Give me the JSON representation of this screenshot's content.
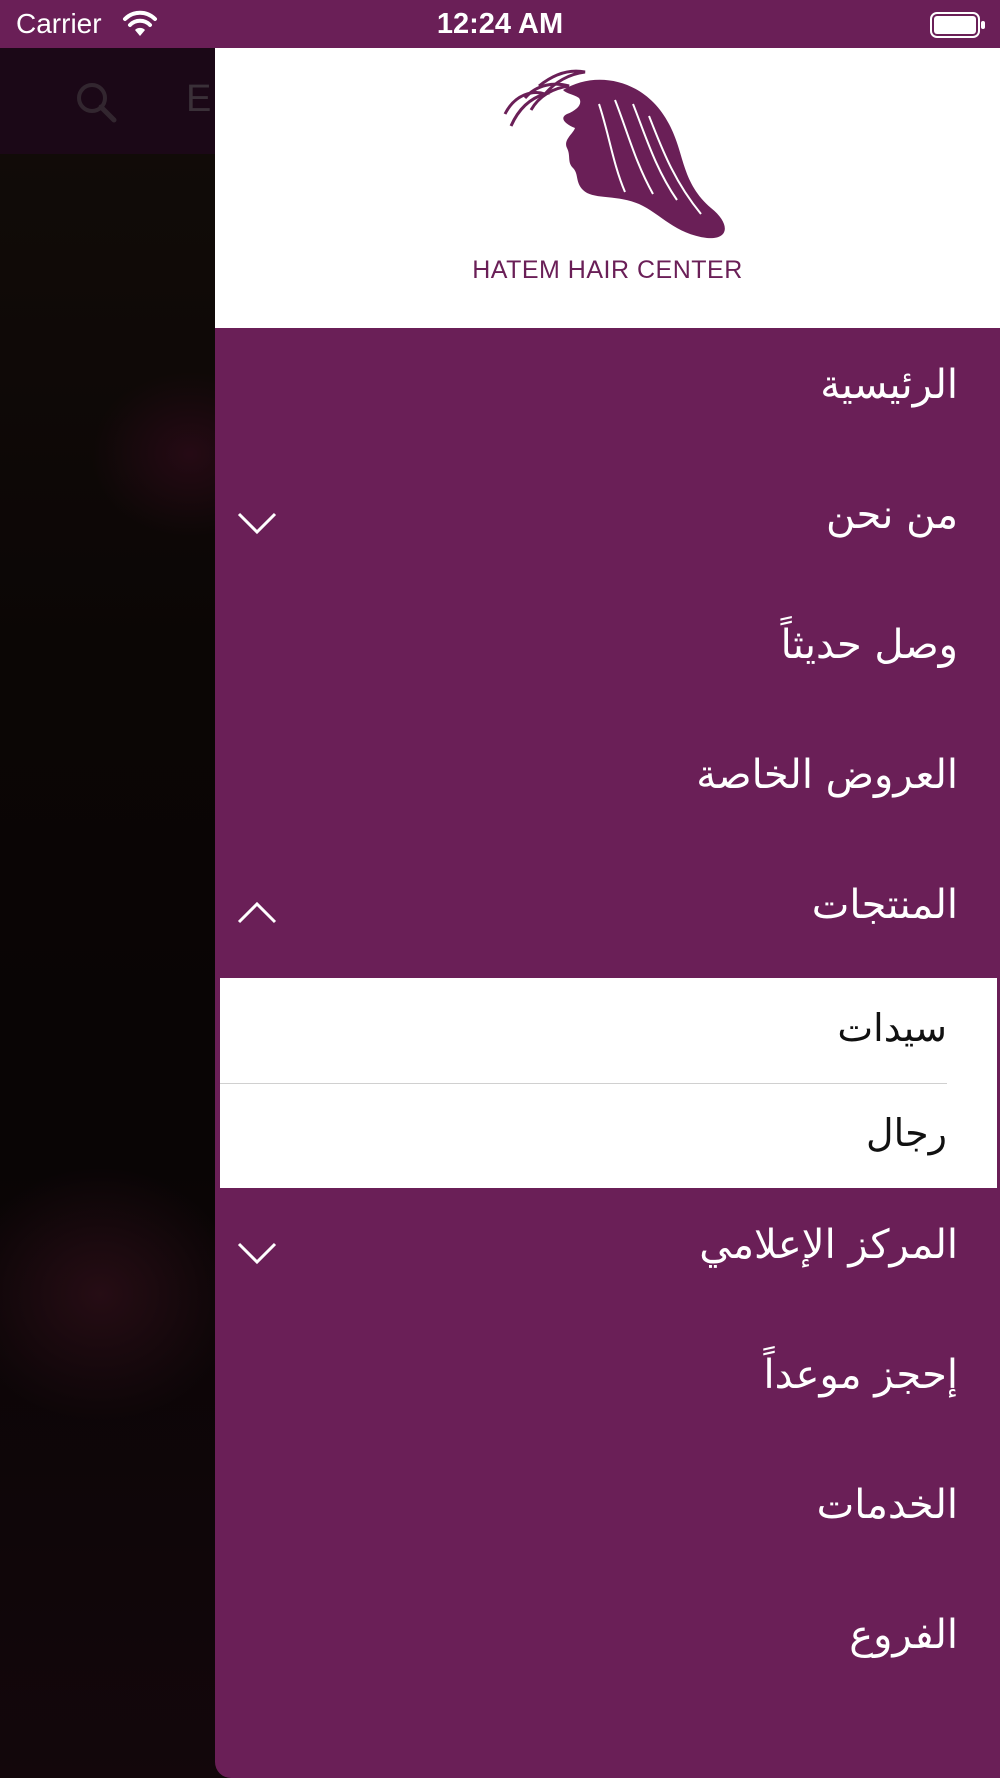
{
  "status_bar": {
    "carrier": "Carrier",
    "time": "12:24 AM",
    "icons": [
      "wifi-icon",
      "battery-icon"
    ]
  },
  "background_app": {
    "lang_label": "E",
    "icons": [
      "search-icon"
    ]
  },
  "drawer": {
    "logo_text": "HATEM HAIR CENTER",
    "accent_color": "#6a1f57",
    "menu": [
      {
        "label": "الرئيسية"
      },
      {
        "label": "من نحن",
        "chevron": "chevron-down-icon"
      },
      {
        "label": "وصل حديثاً"
      },
      {
        "label": "العروض الخاصة"
      },
      {
        "label": "المنتجات",
        "chevron": "chevron-up-icon",
        "expanded": true
      }
    ],
    "products_submenu": [
      {
        "label": "سيدات"
      },
      {
        "label": "رجال"
      }
    ],
    "menu_after": [
      {
        "label": "المركز الإعلامي",
        "chevron": "chevron-down-icon"
      },
      {
        "label": "إحجز موعداً"
      },
      {
        "label": "الخدمات"
      },
      {
        "label": "الفروع"
      }
    ]
  }
}
